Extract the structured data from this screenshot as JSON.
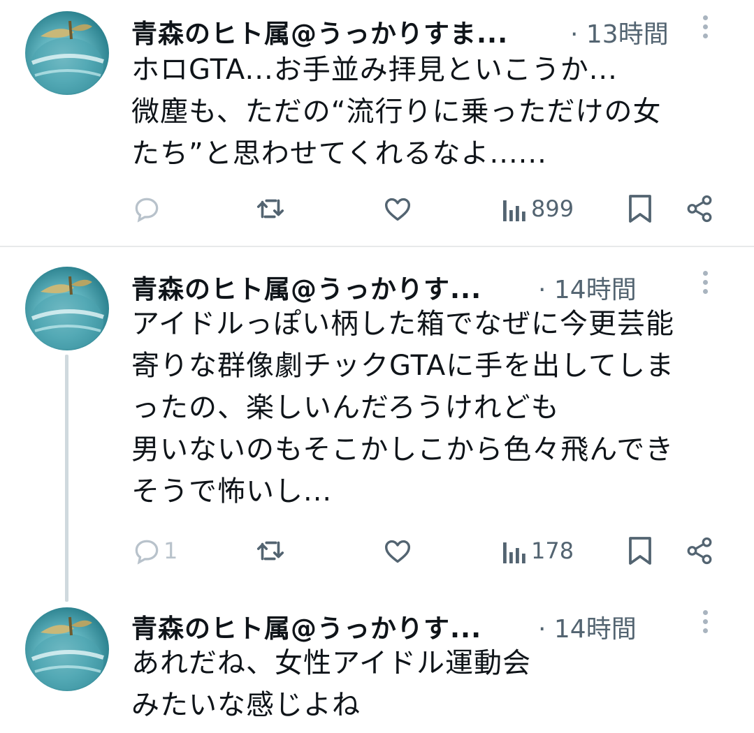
{
  "tweets": [
    {
      "name": "青森のヒト属@うっかりすま...",
      "time": "· 13時間",
      "lines": [
        "ホロGTA...お手並み拝見といこうか...",
        "微塵も、ただの“流行りに乗っただけの女",
        "たち”と思わせてくれるなよ......"
      ],
      "reply_count": "",
      "views": "899"
    },
    {
      "name": "青森のヒト属@うっかりす...",
      "time": "· 14時間",
      "lines": [
        "アイドルっぽい柄した箱でなぜに今更芸能",
        "寄りな群像劇チックGTAに手を出してしま",
        "ったの、楽しいんだろうけれども",
        "男いないのもそこかしこから色々飛んでき",
        "そうで怖いし..."
      ],
      "reply_count": "1",
      "views": "178"
    },
    {
      "name": "青森のヒト属@うっかりす...",
      "time": "· 14時間",
      "lines": [
        "あれだね、女性アイドル運動会",
        "みたいな感じよね"
      ]
    }
  ],
  "icons": [
    "reply-icon",
    "retweet-icon",
    "like-icon",
    "views-icon",
    "bookmark-icon",
    "share-icon",
    "more-icon"
  ],
  "colors": {
    "text": "#0f1419",
    "secondary": "#536471",
    "divider": "#e7e9ea",
    "thread_line": "#cfd9de"
  }
}
